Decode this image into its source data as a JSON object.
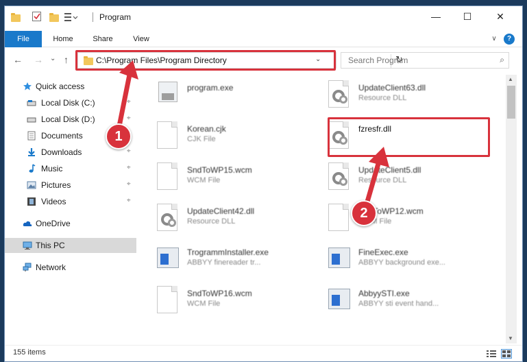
{
  "window": {
    "title": "Program",
    "minimize_icon": "—",
    "maximize_icon": "☐",
    "close_icon": "✕",
    "chevron_icon": "∨",
    "help_icon": "?"
  },
  "ribbon": {
    "tabs": [
      {
        "label": "File"
      },
      {
        "label": "Home"
      },
      {
        "label": "Share"
      },
      {
        "label": "View"
      }
    ]
  },
  "navigation": {
    "back_icon": "←",
    "forward_icon": "→",
    "recent_icon": "⌄",
    "up_icon": "↑"
  },
  "address_bar": {
    "path": "C:\\Program Files\\Program Directory",
    "dropdown_icon": "⌄",
    "refresh_icon": "↻"
  },
  "search": {
    "placeholder": "Search Program",
    "icon": "⌕"
  },
  "sidebar": {
    "items": [
      {
        "label": "Quick access"
      },
      {
        "label": "Local Disk (C:)"
      },
      {
        "label": "Local Disk (D:)"
      },
      {
        "label": "Documents"
      },
      {
        "label": "Downloads"
      },
      {
        "label": "Music"
      },
      {
        "label": "Pictures"
      },
      {
        "label": "Videos"
      },
      {
        "label": "OneDrive"
      },
      {
        "label": "This PC"
      },
      {
        "label": "Network"
      }
    ],
    "pin_icon": "⌖"
  },
  "files": [
    {
      "name": "program.exe",
      "type": ""
    },
    {
      "name": "UpdateClient63.dll",
      "type": "Resource DLL"
    },
    {
      "name": "Korean.cjk",
      "type": "CJK File"
    },
    {
      "name": "fzresfr.dll",
      "type": ""
    },
    {
      "name": "SndToWP15.wcm",
      "type": "WCM File"
    },
    {
      "name": "UpdateClient5.dll",
      "type": "Resource DLL"
    },
    {
      "name": "UpdateClient42.dll",
      "type": "Resource DLL"
    },
    {
      "name": "SndToWP12.wcm",
      "type": "WCM File"
    },
    {
      "name": "TrogrammInstaller.exe",
      "type": "ABBYY finereader tr..."
    },
    {
      "name": "FineExec.exe",
      "type": "ABBYY background exe..."
    },
    {
      "name": "SndToWP16.wcm",
      "type": "WCM File"
    },
    {
      "name": "AbbyySTI.exe",
      "type": "ABBYY sti event hand..."
    }
  ],
  "annotations": {
    "step1": "1",
    "step2": "2",
    "highlight_color": "#d8323c"
  },
  "status": {
    "item_count": "155 items"
  },
  "colors": {
    "accent": "#1979ca",
    "highlight": "#d8323c"
  }
}
